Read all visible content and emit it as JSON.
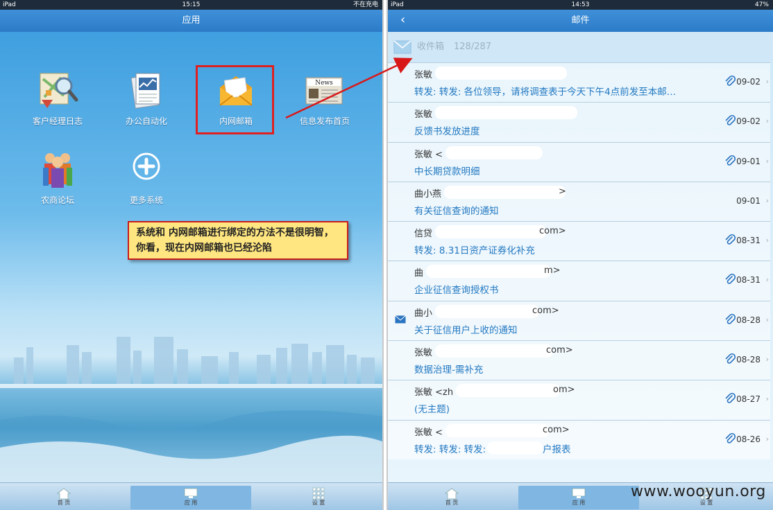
{
  "left": {
    "status": {
      "device": "iPad",
      "time": "15:15",
      "charging": "不在充电"
    },
    "title": "应用",
    "apps": [
      {
        "label": "客户经理日志",
        "icon": "map-search-icon"
      },
      {
        "label": "办公自动化",
        "icon": "document-chart-icon"
      },
      {
        "label": "内网邮箱",
        "icon": "mail-open-icon"
      },
      {
        "label": "信息发布首页",
        "icon": "newspaper-icon"
      },
      {
        "label": "农商论坛",
        "icon": "people-group-icon"
      },
      {
        "label": "更多系统",
        "icon": "plus-circle-icon"
      }
    ],
    "news_icon_text": "News",
    "callout": "系统和 内网邮箱进行绑定的方法不是很明智，你看，现在内网邮箱也已经沦陷",
    "tabs": [
      {
        "label": "首 页",
        "icon": "home-icon"
      },
      {
        "label": "应 用",
        "icon": "monitor-icon",
        "active": true
      },
      {
        "label": "设 置",
        "icon": "grid-icon"
      }
    ]
  },
  "right": {
    "status": {
      "device": "iPad",
      "time": "14:53",
      "battery": "47%"
    },
    "title": "邮件",
    "inbox": {
      "label": "收件箱",
      "count": "128/287"
    },
    "mails": [
      {
        "sender": "张敏",
        "subject": "转发: 转发: 各位领导，请将调查表于今天下午4点前发至本邮…",
        "date": "09-02",
        "attachment": true,
        "unread": false
      },
      {
        "sender": "张敏",
        "subject": "反馈书发放进度",
        "date": "09-02",
        "attachment": true,
        "unread": false
      },
      {
        "sender": "张敏 <",
        "subject": "中长期贷款明细",
        "date": "09-01",
        "attachment": true,
        "unread": false
      },
      {
        "sender": "曲小燕",
        "subject": "有关征信查询的通知",
        "date": "09-01",
        "attachment": false,
        "unread": false
      },
      {
        "sender": "信贷",
        "subject": "转发: 8.31日资产证券化补充",
        "date": "08-31",
        "attachment": true,
        "unread": false
      },
      {
        "sender": "曲",
        "subject": "企业征信查询授权书",
        "date": "08-31",
        "attachment": true,
        "unread": false
      },
      {
        "sender": "曲小",
        "subject": "关于征信用户上收的通知",
        "date": "08-28",
        "attachment": true,
        "unread": true
      },
      {
        "sender": "张敏",
        "subject": "数据治理-需补充",
        "date": "08-28",
        "attachment": true,
        "unread": false
      },
      {
        "sender": "张敏 <zh",
        "subject": "(无主题)",
        "date": "08-27",
        "attachment": true,
        "unread": false
      },
      {
        "sender": "张敏 <",
        "subject": "转发: 转发: 转发:",
        "date": "08-26",
        "attachment": true,
        "unread": false
      }
    ],
    "sender_tails": [
      "",
      "",
      "",
      ">",
      "com>",
      "m>",
      "com>",
      "com>",
      "om>",
      "com>"
    ],
    "subject_tails": [
      "",
      "",
      "",
      "",
      "",
      "",
      "",
      "",
      "",
      "户报表"
    ],
    "tabs": [
      {
        "label": "首 页",
        "icon": "home-icon"
      },
      {
        "label": "应 用",
        "icon": "monitor-icon",
        "active": true
      },
      {
        "label": "设 置",
        "icon": "grid-icon"
      }
    ],
    "watermark": "www.wooyun.org"
  }
}
